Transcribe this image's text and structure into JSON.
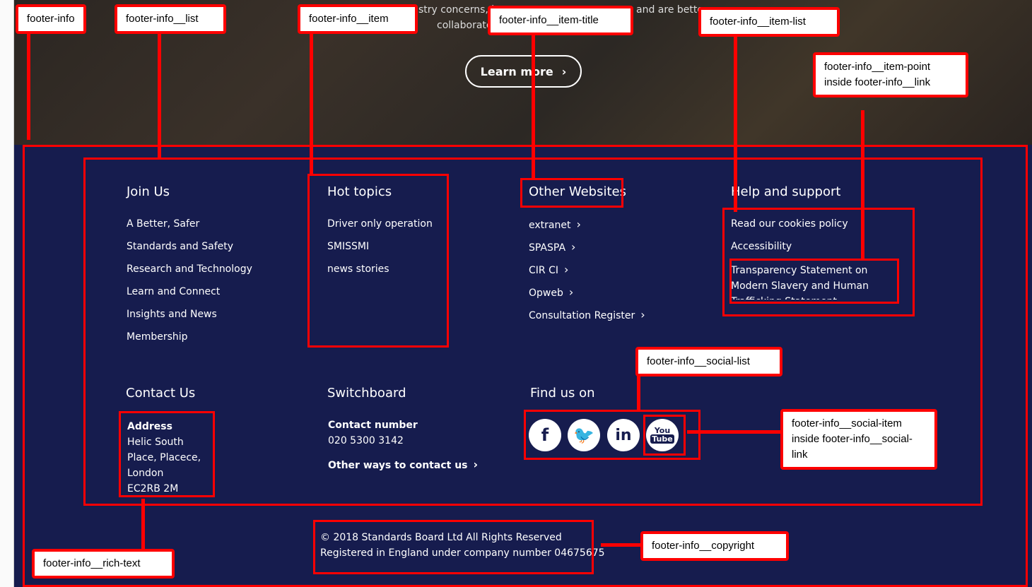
{
  "hero": {
    "text_line1_left": "stry concerns, b",
    "text_line1_right": "and are better",
    "text_line2": "collaborate",
    "learn_more": "Learn more"
  },
  "footer": {
    "columns": [
      {
        "title": "Join Us",
        "items": [
          "A Better, Safer",
          "Standards and Safety",
          "Research and Technology",
          "Learn and Connect",
          "Insights and News",
          "Membership"
        ]
      },
      {
        "title": "Hot topics",
        "items": [
          "Driver only operation",
          "SMISSMI",
          "news stories"
        ]
      },
      {
        "title": "Other Websites",
        "items": [
          "extranet",
          "SPASPA",
          "CIR CI",
          "Opweb",
          "Consultation Register"
        ]
      },
      {
        "title": "Help and support",
        "items": [
          "Read our cookies policy",
          "Accessibility",
          "Transparency Statement on Modern Slavery and Human Trafficking Statement"
        ]
      }
    ],
    "contact": {
      "title": "Contact Us",
      "address_label": "Address",
      "address_lines": [
        "Helic South",
        "Place, Placece,",
        "London",
        "EC2RB 2M"
      ]
    },
    "switchboard": {
      "title": "Switchboard",
      "number_label": "Contact number",
      "number": "020 5300 3142",
      "other_ways": "Other ways to contact us"
    },
    "social": {
      "title": "Find us on",
      "items": [
        "facebook-icon",
        "twitter-icon",
        "linkedin-icon",
        "youtube-icon"
      ]
    },
    "copyright": {
      "line1": "© 2018 Standards Board Ltd All Rights Reserved",
      "line2": "Registered in England under company number 04675675"
    },
    "colors": {
      "background": "#161c4e",
      "annotation": "#ff0000"
    }
  },
  "annotations": [
    "footer-info",
    "footer-info__list",
    "footer-info__item",
    "footer-info__item-title",
    "footer-info__item-list",
    "footer-info__item-point inside footer-info__link",
    "footer-info__social-list",
    "footer-info__social-item inside footer-info__social-link",
    "footer-info__copyright",
    "footer-info__rich-text"
  ]
}
